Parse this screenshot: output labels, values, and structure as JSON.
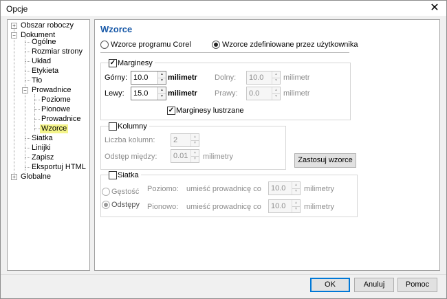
{
  "window": {
    "title": "Opcje",
    "close_glyph": "✕"
  },
  "tree": {
    "items": [
      {
        "label": "Obszar roboczy",
        "expander": "+"
      },
      {
        "label": "Dokument",
        "expander": "−"
      },
      {
        "label": "Ogólne"
      },
      {
        "label": "Rozmiar strony"
      },
      {
        "label": "Układ"
      },
      {
        "label": "Etykieta"
      },
      {
        "label": "Tło"
      },
      {
        "label": "Prowadnice",
        "expander": "−"
      },
      {
        "label": "Poziome"
      },
      {
        "label": "Pionowe"
      },
      {
        "label": "Prowadnice"
      },
      {
        "label": "Wzorce",
        "selected": true
      },
      {
        "label": "Siatka"
      },
      {
        "label": "Linijki"
      },
      {
        "label": "Zapisz"
      },
      {
        "label": "Eksportuj HTML"
      },
      {
        "label": "Globalne",
        "expander": "+"
      }
    ]
  },
  "panel": {
    "title": "Wzorce",
    "preset_options": {
      "corel": "Wzorce programu Corel",
      "user": "Wzorce zdefiniowane przez użytkownika",
      "selected": "user"
    },
    "margins": {
      "label": "Marginesy",
      "checked": true,
      "top_label": "Górny:",
      "top_value": "10.0",
      "left_label": "Lewy:",
      "left_value": "15.0",
      "bottom_label": "Dolny:",
      "bottom_value": "10.0",
      "right_label": "Prawy:",
      "right_value": "0.0",
      "unit": "milimetr",
      "mirror_label": "Marginesy lustrzane",
      "mirror_checked": true
    },
    "columns": {
      "label": "Kolumny",
      "checked": false,
      "count_label": "Liczba kolumn:",
      "count_value": "2",
      "gap_label": "Odstęp między:",
      "gap_value": "0.01",
      "gap_unit": "milimetry"
    },
    "apply_button": "Zastosuj wzorce",
    "grid": {
      "label": "Siatka",
      "checked": false,
      "density_label": "Gęstość",
      "spacing_label": "Odstępy",
      "selected": "spacing",
      "horizontal_label": "Poziomo:",
      "vertical_label": "Pionowo:",
      "place_text": "umieść prowadnicę co",
      "horizontal_value": "10.0",
      "vertical_value": "10.0",
      "unit": "milimetry"
    }
  },
  "footer": {
    "ok": "OK",
    "cancel": "Anuluj",
    "help": "Pomoc"
  },
  "colors": {
    "accent_title": "#1a5aa8",
    "tree_selected": "#f4f48a",
    "primary_border": "#0078d7"
  }
}
